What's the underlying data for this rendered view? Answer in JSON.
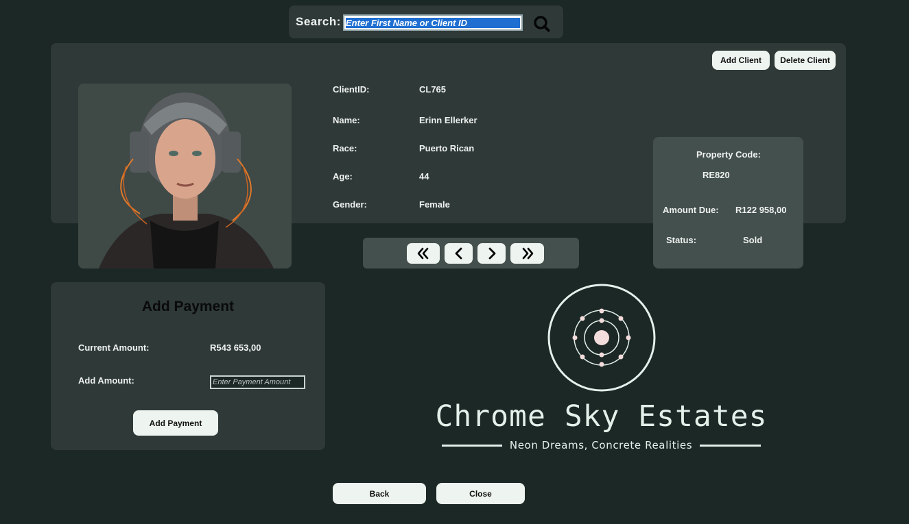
{
  "search": {
    "label": "Search:",
    "placeholder": "Enter First Name or Client ID"
  },
  "actions": {
    "add_client": "Add Client",
    "delete_client": "Delete Client"
  },
  "client": {
    "fields": [
      {
        "label": "ClientID:",
        "value": "CL765"
      },
      {
        "label": "Name:",
        "value": "Erinn Ellerker"
      },
      {
        "label": "Race:",
        "value": "Puerto Rican"
      },
      {
        "label": "Age:",
        "value": "44"
      },
      {
        "label": "Gender:",
        "value": "Female"
      }
    ]
  },
  "property": {
    "code_label": "Property Code:",
    "code_value": "RE820",
    "amount_due_label": "Amount Due:",
    "amount_due_value": "R122 958,00",
    "status_label": "Status:",
    "status_value": "Sold"
  },
  "navigation": [
    "first-icon",
    "previous-icon",
    "next-icon",
    "last-icon"
  ],
  "payment": {
    "title": "Add Payment",
    "current_amount_label": "Current Amount:",
    "current_amount_value": "R543 653,00",
    "add_amount_label": "Add Amount:",
    "add_amount_placeholder": "Enter Payment Amount",
    "add_payment_button": "Add Payment"
  },
  "brand": {
    "name": "Chrome Sky Estates",
    "tagline": "Neon Dreams, Concrete Realities",
    "color": "#e4f0ea"
  },
  "footer": {
    "back": "Back",
    "close": "Close"
  },
  "colors": {
    "background": "#1c2826",
    "panel": "#2f3a38",
    "card": "#44504d",
    "button": "#eef4ef",
    "selection": "#1e6fd1"
  }
}
